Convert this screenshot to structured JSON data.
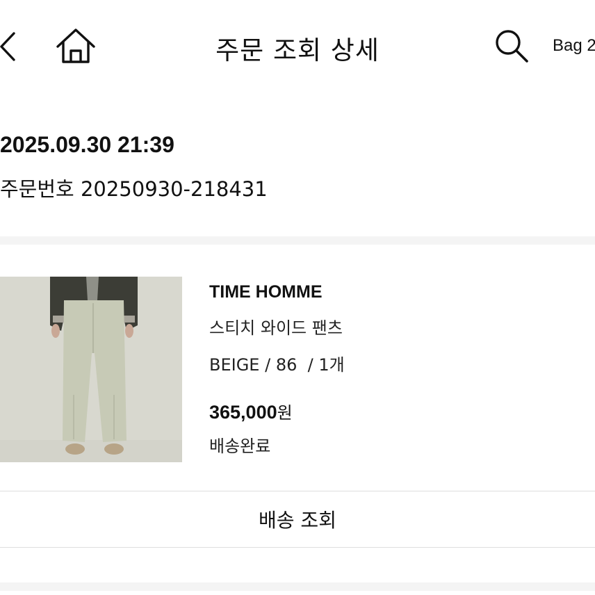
{
  "header": {
    "title": "주문 조회 상세",
    "bag_label": "Bag 2",
    "icons": {
      "back": "chevron-left-icon",
      "home": "home-icon",
      "search": "search-icon"
    }
  },
  "order": {
    "datetime": "2025.09.30 21:39",
    "number_label": "주문번호 20250930-218431"
  },
  "product": {
    "brand": "TIME HOMME",
    "name": "스티치 와이드 팬츠",
    "option": "BEIGE / 86  / 1개",
    "price": "365,000",
    "price_unit": "원",
    "status": "배송완료"
  },
  "actions": {
    "track_label": "배송 조회"
  },
  "colors": {
    "text": "#111111",
    "divider": "#f4f4f4",
    "border": "#dedede",
    "product_background": "#d8d8cf"
  }
}
